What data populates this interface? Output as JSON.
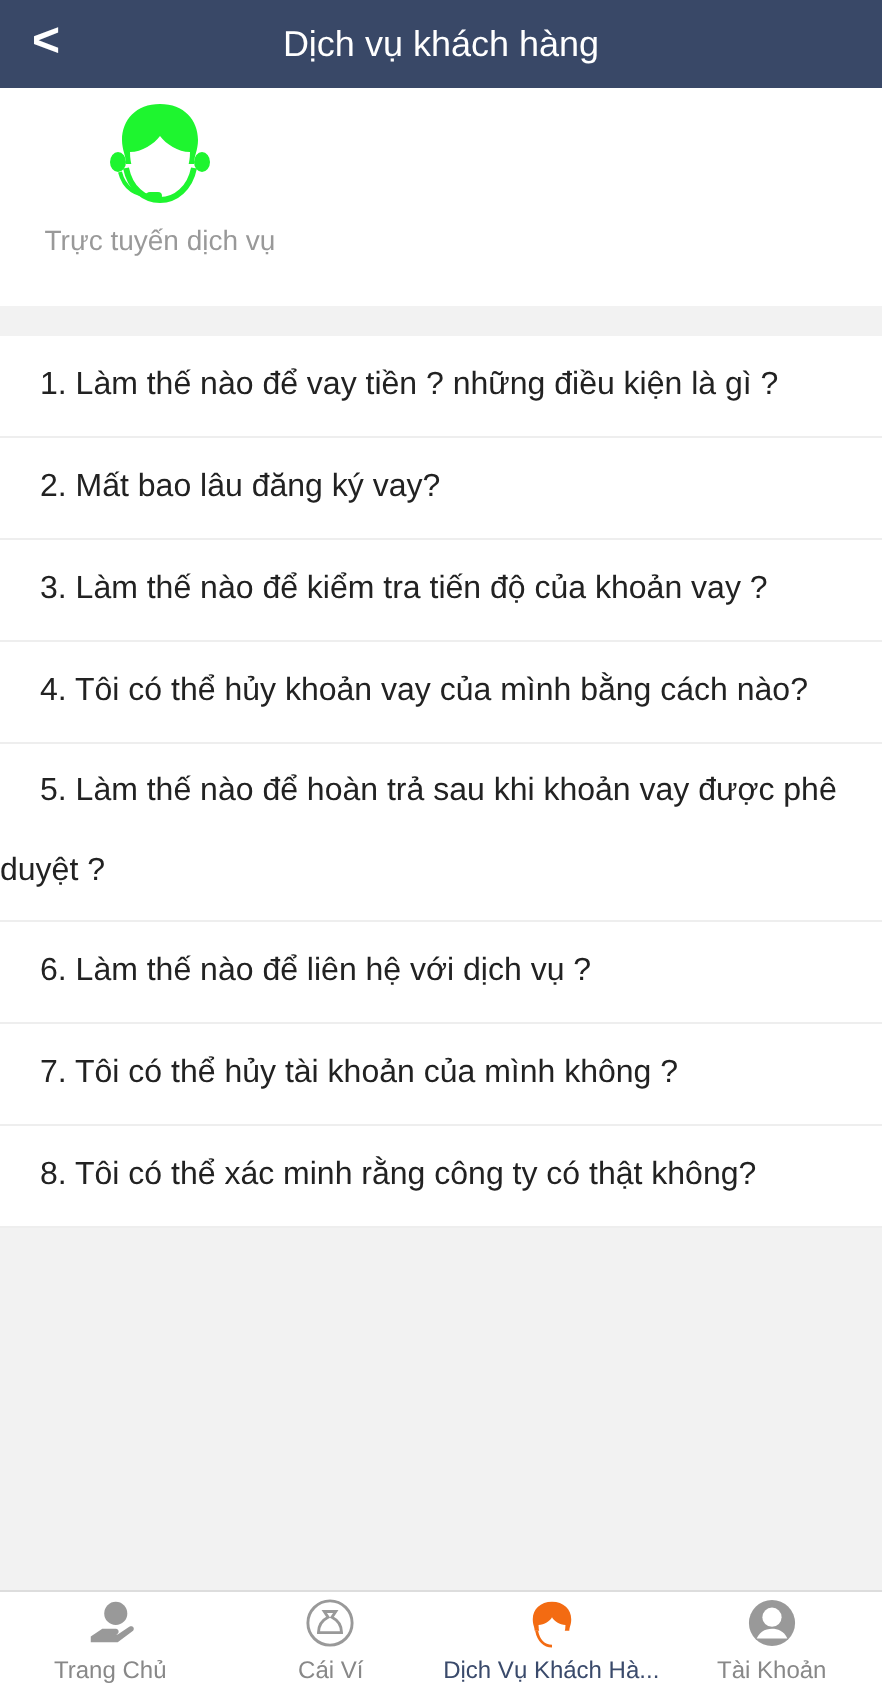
{
  "header": {
    "back": "<",
    "title": "Dịch vụ khách hàng"
  },
  "service": {
    "label": "Trực tuyến dịch vụ"
  },
  "questions": [
    "1. Làm thế nào để vay tiền ? những điều kiện là gì ?",
    "2. Mất bao lâu đăng ký vay?",
    "3. Làm thế nào để kiểm tra tiến độ của khoản vay ?",
    "4. Tôi có thể hủy khoản vay của mình bằng cách nào?",
    "5. Làm thế nào để hoàn trả sau khi khoản vay được phê duyệt ?",
    "6. Làm thế nào để liên hệ với dịch vụ ?",
    "7. Tôi có thể hủy tài khoản của mình không ?",
    "8. Tôi có thể xác minh rằng công ty có thật không?"
  ],
  "tabs": [
    {
      "kind": "home",
      "label": "Trang Chủ",
      "selected": false
    },
    {
      "kind": "wallet",
      "label": "Cái Ví",
      "selected": false
    },
    {
      "kind": "service",
      "label": "Dịch Vụ Khách Hà...",
      "selected": true
    },
    {
      "kind": "account",
      "label": "Tài Khoản",
      "selected": false
    }
  ]
}
